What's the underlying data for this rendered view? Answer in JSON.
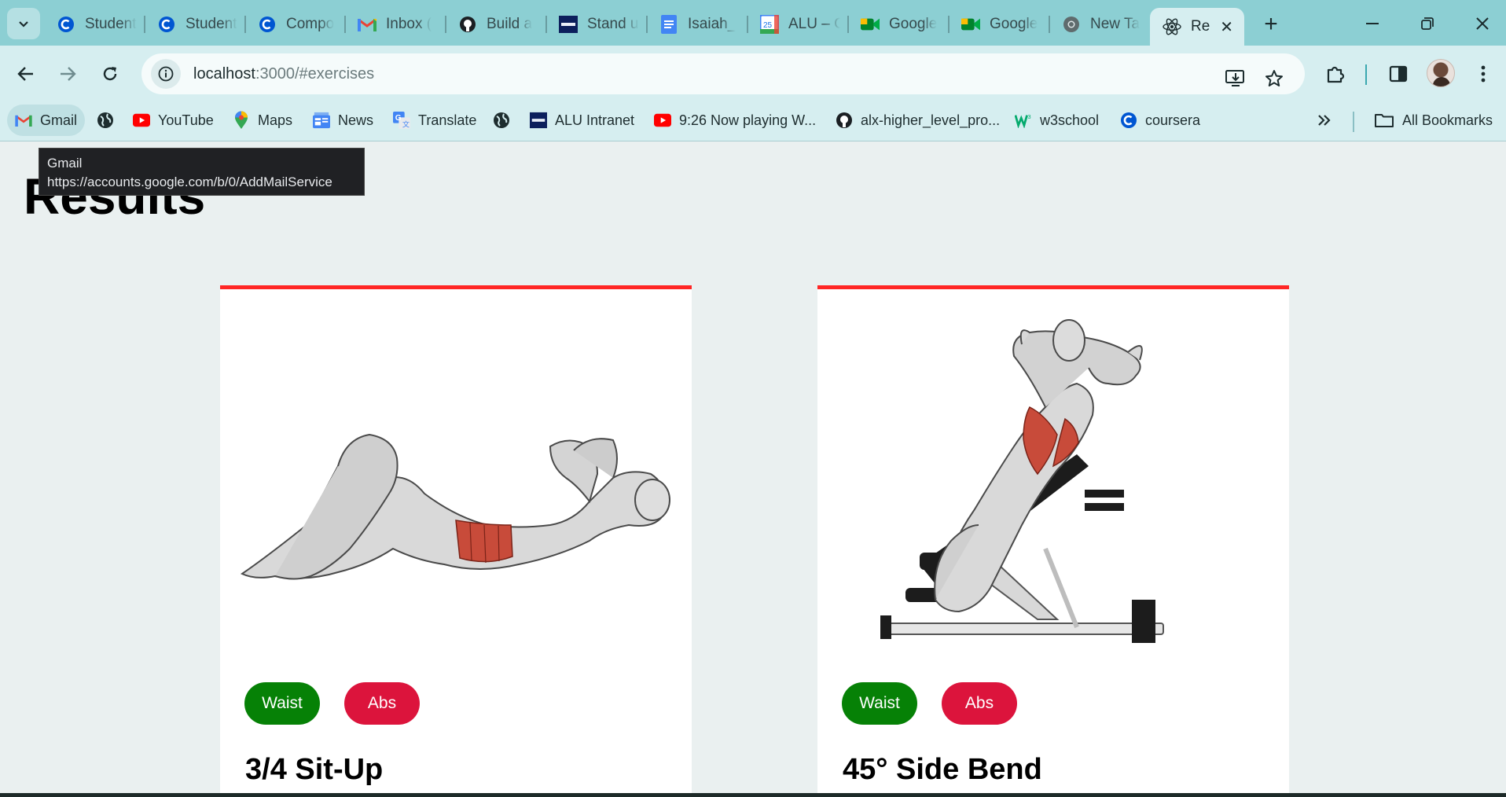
{
  "browser": {
    "tabs": [
      {
        "label": "Student",
        "icon": "coursera-icon",
        "active": false
      },
      {
        "label": "Student",
        "icon": "coursera-icon",
        "active": false
      },
      {
        "label": "Compo",
        "icon": "coursera-icon",
        "active": false
      },
      {
        "label": "Inbox (",
        "icon": "gmail-icon",
        "active": false
      },
      {
        "label": "Build a",
        "icon": "github-icon",
        "active": false
      },
      {
        "label": "Stand u",
        "icon": "alu-icon",
        "active": false
      },
      {
        "label": "Isaiah_",
        "icon": "docs-icon",
        "active": false
      },
      {
        "label": "ALU – C",
        "icon": "calendar-icon",
        "active": false
      },
      {
        "label": "Google",
        "icon": "meet-icon",
        "active": false
      },
      {
        "label": "Google",
        "icon": "meet-icon",
        "active": false
      },
      {
        "label": "New Ta",
        "icon": "chrome-icon",
        "active": false
      },
      {
        "label": "Re",
        "icon": "react-icon",
        "active": true
      }
    ],
    "address": {
      "host": "localhost",
      "path": ":3000/#exercises"
    },
    "bookmarks": [
      {
        "label": "Gmail",
        "icon": "gmail-icon"
      },
      {
        "label": "",
        "icon": "globe-icon"
      },
      {
        "label": "YouTube",
        "icon": "youtube-icon"
      },
      {
        "label": "Maps",
        "icon": "maps-icon"
      },
      {
        "label": "News",
        "icon": "news-icon"
      },
      {
        "label": "Translate",
        "icon": "translate-icon"
      },
      {
        "label": "",
        "icon": "globe-icon"
      },
      {
        "label": "ALU Intranet",
        "icon": "alu-icon"
      },
      {
        "label": "9:26 Now playing W...",
        "icon": "youtube-icon"
      },
      {
        "label": "alx-higher_level_pro...",
        "icon": "github-icon"
      },
      {
        "label": "w3school",
        "icon": "w3-icon"
      },
      {
        "label": "coursera",
        "icon": "coursera-icon"
      }
    ],
    "all_bookmarks_label": "All Bookmarks",
    "tooltip": {
      "title": "Gmail",
      "url": "https://accounts.google.com/b/0/AddMailService"
    }
  },
  "page": {
    "heading": "Results",
    "cards": [
      {
        "body_part": "Waist",
        "target": "Abs",
        "name": "3/4 Sit-Up"
      },
      {
        "body_part": "Waist",
        "target": "Abs",
        "name": "45° Side Bend"
      }
    ]
  },
  "colors": {
    "accent": "#ff2625",
    "body_pill": "#068106",
    "target_pill": "#dc143c",
    "tab_strip": "#8ccfd3"
  }
}
